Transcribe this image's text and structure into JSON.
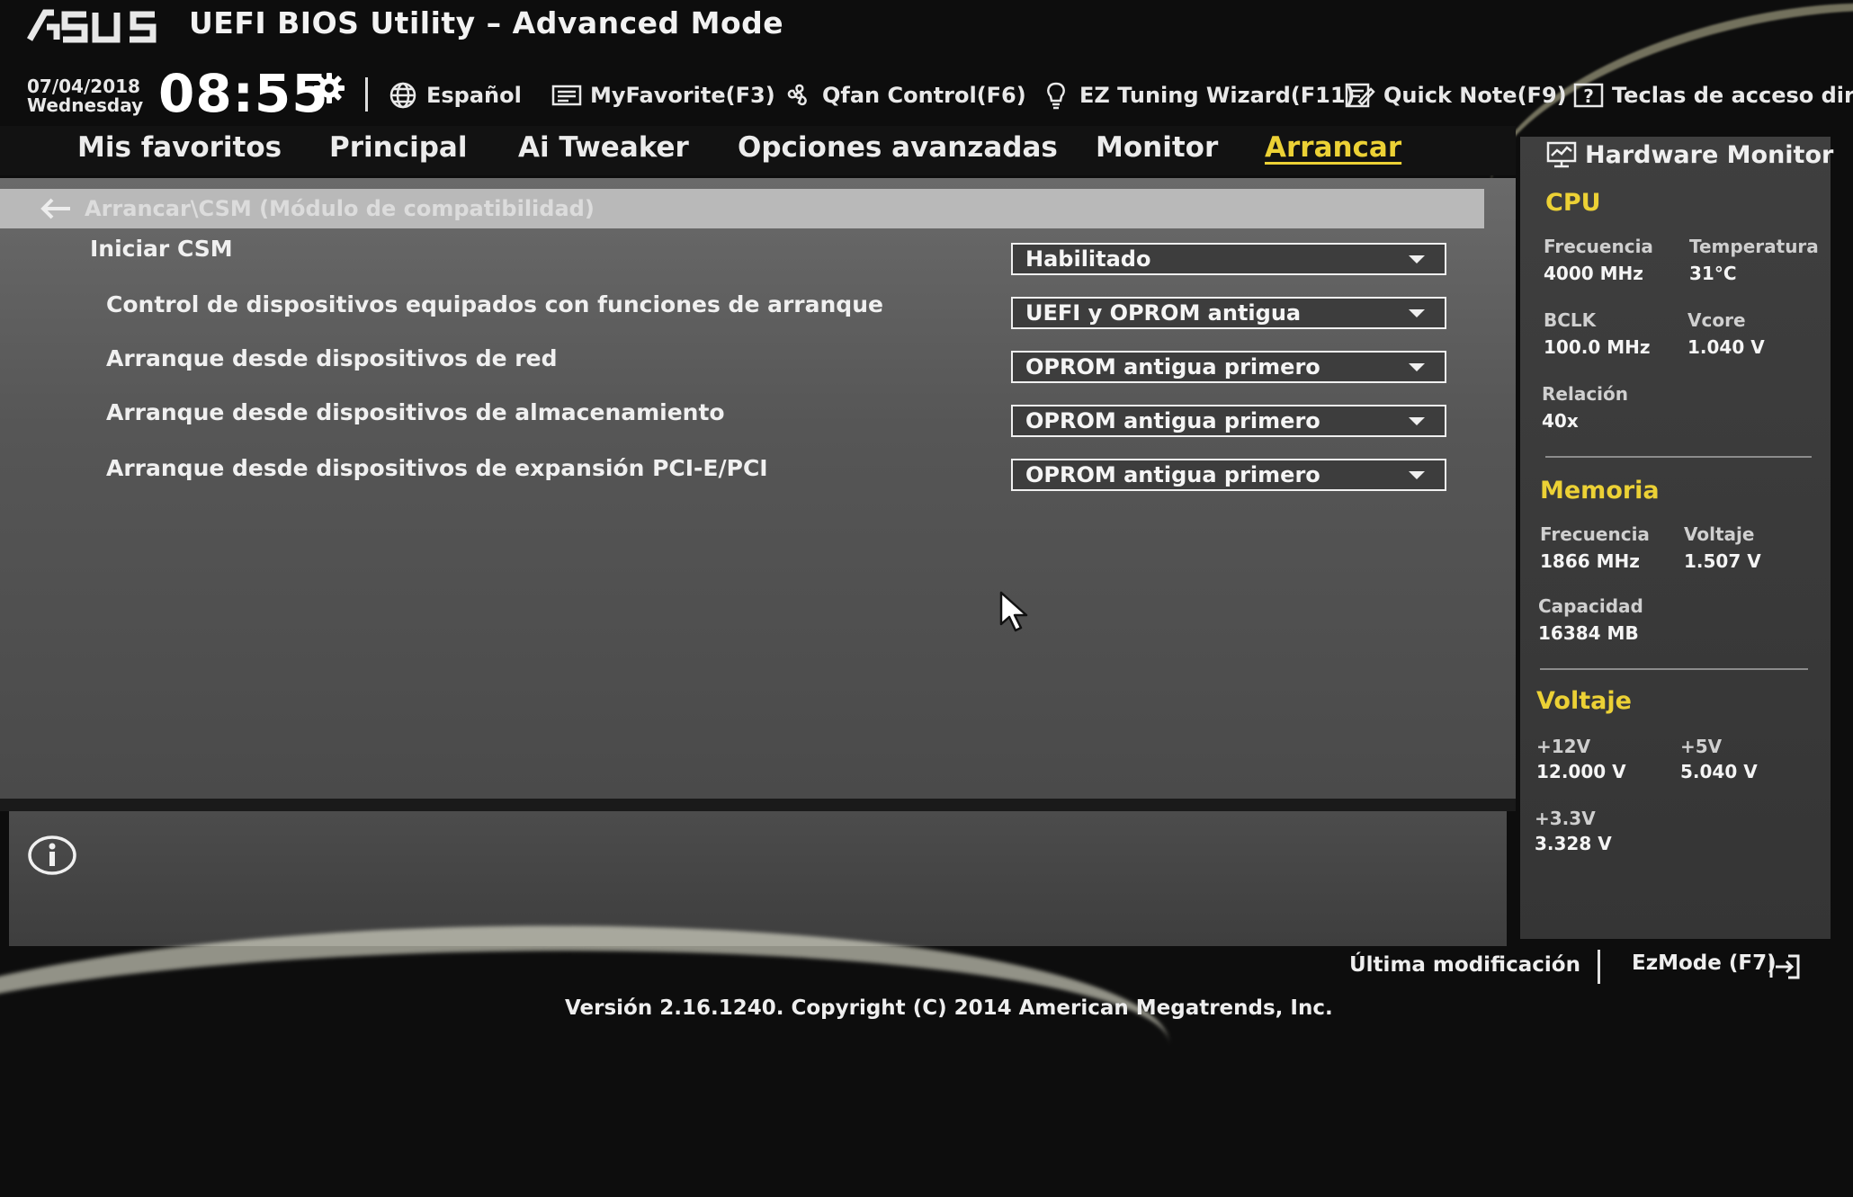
{
  "header": {
    "logo_text": "ASUS",
    "title": "UEFI BIOS Utility – Advanced Mode",
    "date": "07/04/2018",
    "weekday": "Wednesday",
    "time": "08:55",
    "toolbar": [
      {
        "icon": "globe-icon",
        "label": "Español"
      },
      {
        "icon": "favorites-icon",
        "label": "MyFavorite(F3)"
      },
      {
        "icon": "fan-icon",
        "label": "Qfan Control(F6)"
      },
      {
        "icon": "bulb-icon",
        "label": "EZ Tuning Wizard(F11)"
      },
      {
        "icon": "note-icon",
        "label": "Quick Note(F9)"
      },
      {
        "icon": "help-icon",
        "label": "Teclas de acceso directo"
      }
    ]
  },
  "tabs": [
    {
      "label": "Mis favoritos",
      "active": false
    },
    {
      "label": "Principal",
      "active": false
    },
    {
      "label": "Ai Tweaker",
      "active": false
    },
    {
      "label": "Opciones avanzadas",
      "active": false
    },
    {
      "label": "Monitor",
      "active": false
    },
    {
      "label": "Arrancar",
      "active": true
    }
  ],
  "breadcrumb": "Arrancar\\CSM (Módulo de compatibilidad)",
  "options": [
    {
      "label": "Iniciar CSM",
      "value": "Habilitado"
    },
    {
      "label": "Control de dispositivos equipados con funciones de arranque",
      "value": "UEFI y OPROM antigua"
    },
    {
      "label": "Arranque desde dispositivos de red",
      "value": "OPROM antigua primero"
    },
    {
      "label": "Arranque desde dispositivos de almacenamiento",
      "value": "OPROM antigua primero"
    },
    {
      "label": "Arranque desde dispositivos de expansión PCI-E/PCI",
      "value": "OPROM antigua primero"
    }
  ],
  "hardware_monitor": {
    "title": "Hardware Monitor",
    "cpu": {
      "heading": "CPU",
      "freq_label": "Frecuencia",
      "freq": "4000 MHz",
      "temp_label": "Temperatura",
      "temp": "31°C",
      "bclk_label": "BCLK",
      "bclk": "100.0 MHz",
      "vcore_label": "Vcore",
      "vcore": "1.040 V",
      "ratio_label": "Relación",
      "ratio": "40x"
    },
    "memory": {
      "heading": "Memoria",
      "freq_label": "Frecuencia",
      "freq": "1866 MHz",
      "volt_label": "Voltaje",
      "volt": "1.507 V",
      "cap_label": "Capacidad",
      "cap": "16384 MB"
    },
    "voltage": {
      "heading": "Voltaje",
      "v12_label": "+12V",
      "v12": "12.000 V",
      "v5_label": "+5V",
      "v5": "5.040 V",
      "v33_label": "+3.3V",
      "v33": "3.328 V"
    }
  },
  "footer": {
    "last_modified": "Última modificación",
    "ezmode": "EzMode (F7)",
    "version": "Versión 2.16.1240. Copyright (C) 2014 American Megatrends, Inc."
  },
  "colors": {
    "accent": "#ecd135",
    "background": "#0d0d0d",
    "panel": "#565656"
  }
}
